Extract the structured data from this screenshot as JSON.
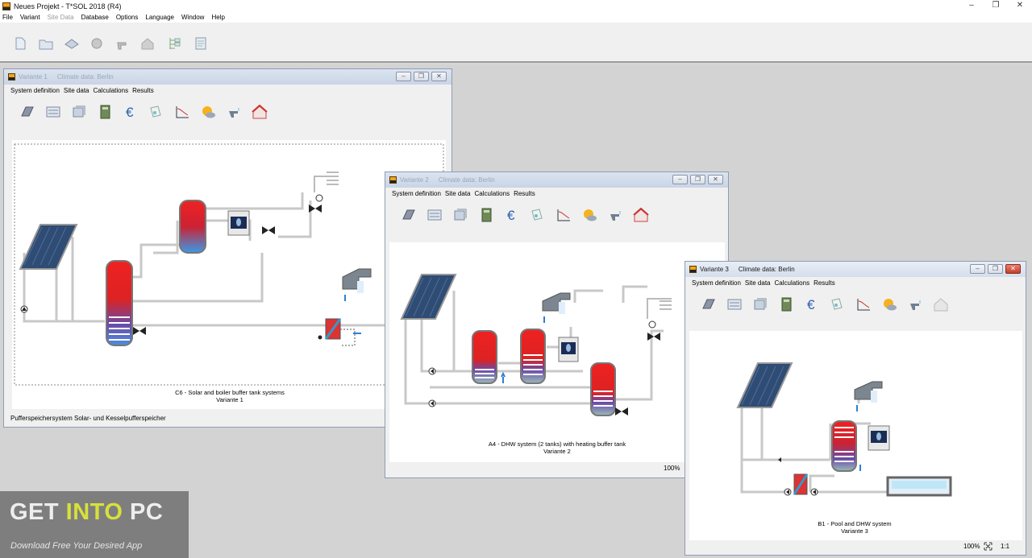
{
  "app": {
    "title": "Neues Projekt - T*SOL 2018 (R4)",
    "controls": {
      "minimize": "–",
      "restore": "❐",
      "close": "✕"
    }
  },
  "menu": [
    {
      "label": "File",
      "disabled": false
    },
    {
      "label": "Variant",
      "disabled": false
    },
    {
      "label": "Site Data",
      "disabled": true
    },
    {
      "label": "Database",
      "disabled": false
    },
    {
      "label": "Options",
      "disabled": false
    },
    {
      "label": "Language",
      "disabled": false
    },
    {
      "label": "Window",
      "disabled": false
    },
    {
      "label": "Help",
      "disabled": false
    }
  ],
  "toolbar_icons": [
    "new-file-icon",
    "open-folder-icon",
    "save-icon",
    "weather-icon",
    "tap-icon",
    "house-icon",
    "tree-icon",
    "report-icon"
  ],
  "child_menu": {
    "system_definition": "System definition",
    "site_data": "Site data",
    "calculations": "Calculations",
    "results": "Results"
  },
  "child_tool_icons": [
    "collector-icon",
    "system-icon",
    "storage-icon",
    "calculator-icon",
    "euro-icon",
    "report-icon",
    "chart-icon",
    "sun-cloud-icon",
    "tap-icon",
    "house-icon"
  ],
  "windows": {
    "v1": {
      "variant": "Variante 1",
      "climate": "Climate data: Berlin",
      "caption_line1": "C6 - Solar and boiler buffer tank systems",
      "caption_line2": "Variante 1",
      "status": "Pufferspeichersystem Solar- und Kesselpufferspeicher"
    },
    "v2": {
      "variant": "Variante 2",
      "climate": "Climate data: Berlin",
      "caption_line1": "A4 - DHW system (2 tanks) with heating buffer tank",
      "caption_line2": "Variante 2",
      "zoom": "100%"
    },
    "v3": {
      "variant": "Variante 3",
      "climate": "Climate data: Berlin",
      "caption_line1": "B1 - Pool and DHW system",
      "caption_line2": "Variante 3",
      "zoom": "100%",
      "ratio": "1:1"
    }
  },
  "watermark": {
    "get": "GET ",
    "into": "INTO",
    "pc": " PC",
    "tagline": "Download Free Your Desired App"
  },
  "colors": {
    "accent_orange": "#f2a31b",
    "tank_red": "#e02a2a",
    "tank_blue": "#3a8fe0",
    "pipe": "#c8c8c8",
    "watermark_yellow": "#d8e03a"
  }
}
